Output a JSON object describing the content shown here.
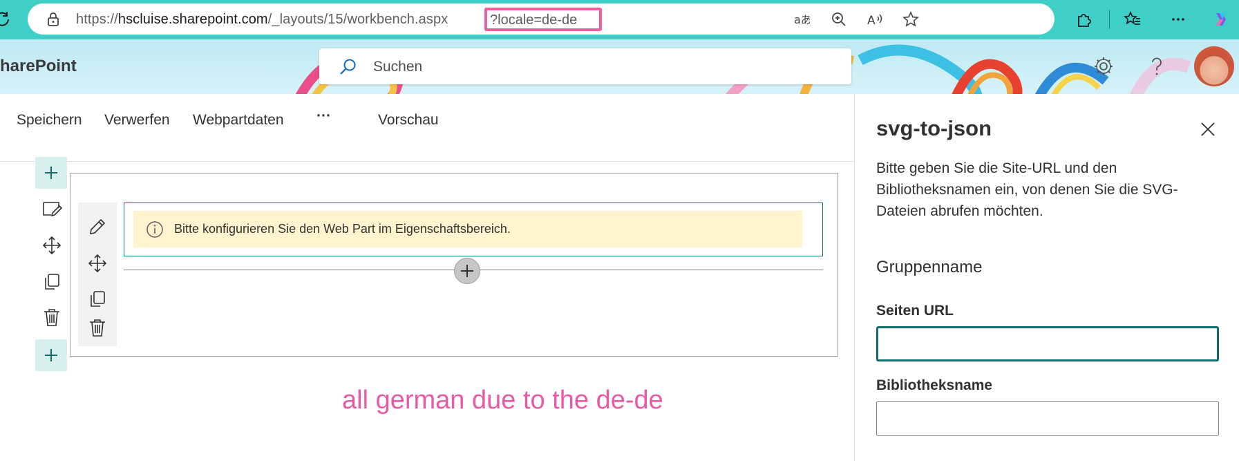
{
  "browser": {
    "url_host_prefix": "https://",
    "url_host": "hscluise.sharepoint.com",
    "url_path": "/_layouts/15/workbench.aspx",
    "url_query": "?locale=de-de",
    "icons": [
      "refresh-icon",
      "lock-icon",
      "read-aloud-translate-icon",
      "zoom-icon",
      "read-aloud-icon",
      "favorite-star-icon",
      "extensions-icon",
      "favorites-icon",
      "more-icon",
      "copilot-icon"
    ]
  },
  "header": {
    "brand": "harePoint",
    "search_placeholder": "Suchen",
    "icons": [
      "settings-gear-icon",
      "help-icon"
    ]
  },
  "commandbar": {
    "save": "Speichern",
    "discard": "Verwerfen",
    "webpart_data": "Webpartdaten",
    "more": "···",
    "preview": "Vorschau"
  },
  "canvas": {
    "message": "Bitte konfigurieren Sie den Web Part im Eigenschaftsbereich."
  },
  "annotation": "all german due to the de-de",
  "property_pane": {
    "title": "svg-to-json",
    "description": "Bitte geben Sie die Site-URL und den Bibliotheksnamen ein, von denen Sie die SVG-Dateien abrufen möchten.",
    "group_name": "Gruppenname",
    "site_url_label": "Seiten URL",
    "site_url_value": "",
    "library_label": "Bibliotheksname",
    "library_value": ""
  },
  "colors": {
    "browser_bar": "#3fcfc7",
    "accent": "#0f6e6a",
    "warning_bg": "#fff4ce",
    "annotation": "#e85ba4"
  }
}
